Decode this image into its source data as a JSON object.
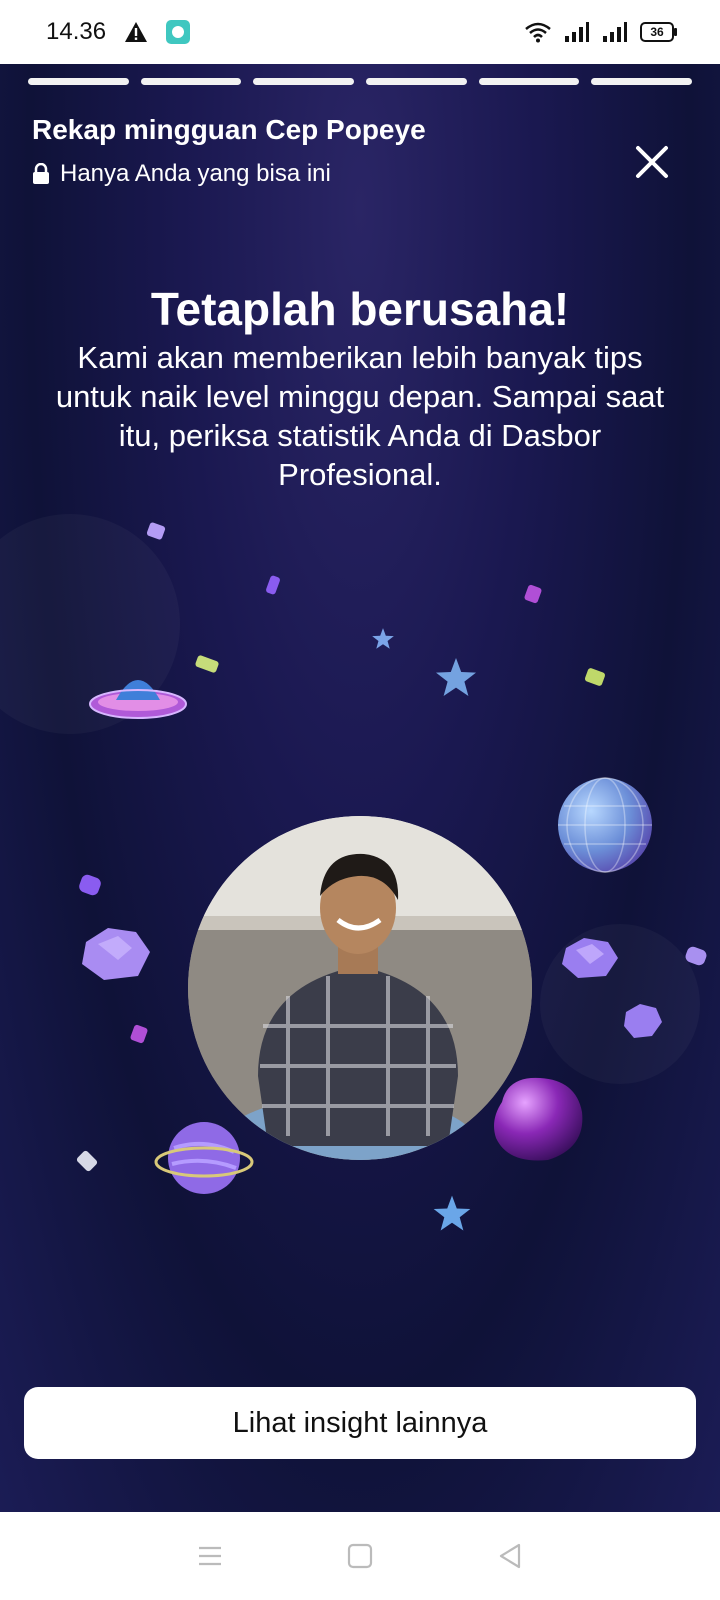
{
  "status_bar": {
    "time": "14.36",
    "battery": "36",
    "icons": [
      "warning-icon",
      "app-notification-icon",
      "wifi-icon",
      "signal-icon",
      "signal-icon",
      "battery-icon"
    ]
  },
  "story": {
    "progress_segments": 6,
    "title": "Rekap mingguan Cep Popeye",
    "privacy_text": "Hanya Anda yang bisa ini",
    "headline": "Tetaplah berusaha!",
    "body": "Kami akan memberikan lebih banyak tips untuk naik level minggu depan. Sampai saat itu, periksa statistik Anda di Dasbor Profesional.",
    "cta_label": "Lihat insight lainnya"
  },
  "colors": {
    "background_top": "#2a2565",
    "background_mid": "#0f1238",
    "accent_purple": "#8a5cf0",
    "accent_blue": "#6aa6e8",
    "white": "#ffffff"
  },
  "nav_bar": {
    "icons": [
      "menu-icon",
      "home-square-icon",
      "back-triangle-icon"
    ]
  }
}
